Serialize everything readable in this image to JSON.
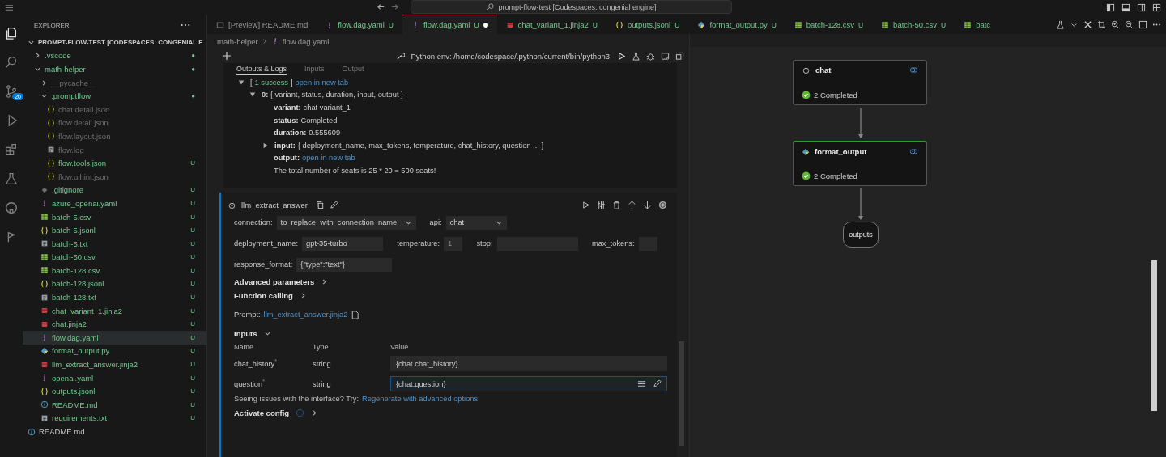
{
  "title_bar": {
    "search": "prompt-flow-test [Codespaces: congenial engine]"
  },
  "activity_bar": [
    {
      "kind": "files",
      "selected": true
    },
    {
      "kind": "search",
      "selected": false
    },
    {
      "kind": "source-control",
      "selected": false,
      "badge": "20"
    },
    {
      "kind": "run",
      "selected": false
    },
    {
      "kind": "extensions",
      "selected": false
    },
    {
      "kind": "flask",
      "selected": false
    },
    {
      "kind": "github",
      "selected": false
    },
    {
      "kind": "promptflow",
      "selected": false
    }
  ],
  "explorer": {
    "title": "EXPLORER",
    "items": [
      {
        "label": "PROMPT-FLOW-TEST [CODESPACES: CONGENIAL E...",
        "kind": "root",
        "expanded": true,
        "selected": false,
        "ignored": false,
        "children": [
          {
            "label": ".vscode",
            "kind": "folder",
            "expanded": false,
            "selected": false,
            "ignored": false,
            "badge": "●"
          },
          {
            "label": "math-helper",
            "kind": "folder",
            "expanded": true,
            "selected": false,
            "ignored": false,
            "badge": "●",
            "children": [
              {
                "label": "__pycache__",
                "kind": "folder",
                "expanded": false,
                "selected": false,
                "ignored": true
              },
              {
                "label": ".promptflow",
                "kind": "folder",
                "expanded": true,
                "selected": false,
                "ignored": false,
                "badge": "●",
                "children": [
                  {
                    "label": "chat.detail.json",
                    "kind": "json",
                    "selected": false,
                    "ignored": true
                  },
                  {
                    "label": "flow.detail.json",
                    "kind": "json",
                    "selected": false,
                    "ignored": true
                  },
                  {
                    "label": "flow.layout.json",
                    "kind": "json",
                    "selected": false,
                    "ignored": true
                  },
                  {
                    "label": "flow.log",
                    "kind": "text",
                    "selected": false,
                    "ignored": true
                  },
                  {
                    "label": "flow.tools.json",
                    "kind": "json",
                    "selected": false,
                    "ignored": false,
                    "badge": "U"
                  },
                  {
                    "label": "flow.uihint.json",
                    "kind": "json",
                    "selected": false,
                    "ignored": true
                  }
                ]
              },
              {
                "label": ".gitignore",
                "kind": "git",
                "selected": false,
                "ignored": false,
                "badge": "U"
              },
              {
                "label": "azure_openai.yaml",
                "kind": "yaml",
                "selected": false,
                "ignored": false,
                "badge": "U"
              },
              {
                "label": "batch-5.csv",
                "kind": "csv",
                "selected": false,
                "ignored": false,
                "badge": "U"
              },
              {
                "label": "batch-5.jsonl",
                "kind": "json",
                "selected": false,
                "ignored": false,
                "badge": "U"
              },
              {
                "label": "batch-5.txt",
                "kind": "text",
                "selected": false,
                "ignored": false,
                "badge": "U"
              },
              {
                "label": "batch-50.csv",
                "kind": "csv",
                "selected": false,
                "ignored": false,
                "badge": "U"
              },
              {
                "label": "batch-128.csv",
                "kind": "csv",
                "selected": false,
                "ignored": false,
                "badge": "U"
              },
              {
                "label": "batch-128.jsonl",
                "kind": "json",
                "selected": false,
                "ignored": false,
                "badge": "U"
              },
              {
                "label": "batch-128.txt",
                "kind": "text",
                "selected": false,
                "ignored": false,
                "badge": "U"
              },
              {
                "label": "chat_variant_1.jinja2",
                "kind": "jinja",
                "selected": false,
                "ignored": false,
                "badge": "U"
              },
              {
                "label": "chat.jinja2",
                "kind": "jinja",
                "selected": false,
                "ignored": false,
                "badge": "U"
              },
              {
                "label": "flow.dag.yaml",
                "kind": "yaml",
                "selected": true,
                "ignored": false,
                "badge": "U"
              },
              {
                "label": "format_output.py",
                "kind": "python",
                "selected": false,
                "ignored": false,
                "badge": "U"
              },
              {
                "label": "llm_extract_answer.jinja2",
                "kind": "jinja",
                "selected": false,
                "ignored": false,
                "badge": "U"
              },
              {
                "label": "openai.yaml",
                "kind": "yaml",
                "selected": false,
                "ignored": false,
                "badge": "U"
              },
              {
                "label": "outputs.jsonl",
                "kind": "json",
                "selected": false,
                "ignored": false,
                "badge": "U"
              },
              {
                "label": "README.md",
                "kind": "info",
                "selected": false,
                "ignored": false,
                "badge": "U"
              },
              {
                "label": "requirements.txt",
                "kind": "text",
                "selected": false,
                "ignored": false,
                "badge": "U"
              }
            ]
          }
        ]
      },
      {
        "label": "README.md",
        "kind": "info",
        "selected": false,
        "ignored": false
      }
    ]
  },
  "tabs": [
    {
      "label": "[Preview] README.md",
      "kind": "preview",
      "selected": false,
      "dirty": false,
      "untracked": false
    },
    {
      "label": "flow.dag.yaml",
      "kind": "yaml",
      "status": "U",
      "selected": false,
      "dirty": false,
      "untracked": true
    },
    {
      "label": "flow.dag.yaml",
      "kind": "yaml",
      "status": "U",
      "selected": true,
      "dirty": true,
      "untracked": true
    },
    {
      "label": "chat_variant_1.jinja2",
      "kind": "jinja",
      "status": "U",
      "selected": false,
      "dirty": false,
      "untracked": true
    },
    {
      "label": "outputs.jsonl",
      "kind": "json",
      "status": "U",
      "selected": false,
      "dirty": false,
      "untracked": true
    },
    {
      "label": "format_output.py",
      "kind": "python",
      "status": "U",
      "selected": false,
      "dirty": false,
      "untracked": true
    },
    {
      "label": "batch-128.csv",
      "kind": "csv",
      "status": "U",
      "selected": false,
      "dirty": false,
      "untracked": true
    },
    {
      "label": "batch-50.csv",
      "kind": "csv",
      "status": "U",
      "selected": false,
      "dirty": false,
      "untracked": true
    },
    {
      "label": "batc",
      "kind": "csv",
      "selected": false,
      "dirty": false,
      "untracked": true
    }
  ],
  "breadcrumb": [
    {
      "label": "math-helper",
      "kind": "folder"
    },
    {
      "label": "flow.dag.yaml",
      "kind": "yaml"
    }
  ],
  "toolbar": {
    "env": "Python env: /home/codespace/.python/current/bin/python3"
  },
  "outputs_panel": {
    "tabs": [
      {
        "label": "Outputs & Logs",
        "selected": true
      },
      {
        "label": "Inputs",
        "selected": false
      },
      {
        "label": "Output",
        "selected": false
      }
    ],
    "summary": {
      "open": "[",
      "status": "1 success",
      "close": "]",
      "link": "open in new tab",
      "expanded": true
    },
    "entry": {
      "key": "0:",
      "summary": "{ variant, status, duration, input, output }",
      "expanded": true,
      "fields": [
        {
          "key": "variant:",
          "value": "chat variant_1",
          "kind": "text"
        },
        {
          "key": "status:",
          "value": "Completed",
          "kind": "text"
        },
        {
          "key": "duration:",
          "value": "0.555609",
          "kind": "text"
        },
        {
          "key": "input:",
          "value": "{ deployment_name, max_tokens, temperature, chat_history, question ... }",
          "kind": "collapsed"
        },
        {
          "key": "output:",
          "value": "open in new tab",
          "kind": "link"
        }
      ],
      "result": "The total number of seats is 25 * 20 = 500 seats!"
    }
  },
  "node": {
    "title": "llm_extract_answer",
    "rows": [
      [
        {
          "label": "connection:",
          "value": "to_replace_with_connection_name",
          "kind": "select"
        },
        {
          "label": "api:",
          "value": "chat",
          "kind": "select"
        }
      ],
      [
        {
          "label": "deployment_name:",
          "value": "gpt-35-turbo",
          "kind": "input"
        },
        {
          "label": "temperature:",
          "placeholder": "1",
          "kind": "small"
        },
        {
          "label": "stop:",
          "kind": "input"
        },
        {
          "label": "max_tokens:",
          "kind": "small"
        }
      ],
      [
        {
          "label": "response_format:",
          "value": "{\"type\":\"text\"}",
          "kind": "input"
        }
      ]
    ],
    "sections": [
      {
        "label": "Advanced parameters",
        "expanded": false
      },
      {
        "label": "Function calling",
        "expanded": false
      }
    ],
    "prompt": {
      "label": "Prompt:",
      "link": "llm_extract_answer.jinja2"
    },
    "inputs": {
      "title": "Inputs",
      "expanded": true,
      "columns": [
        "Name",
        "Type",
        "Value"
      ],
      "rows": [
        {
          "name": "chat_history",
          "required": "*",
          "type": "string",
          "value": "{chat.chat_history}",
          "focused": false
        },
        {
          "name": "question",
          "required": "*",
          "type": "string",
          "value": "{chat.question}",
          "focused": true
        }
      ]
    },
    "hint": {
      "text": "Seeing issues with the interface? Try:",
      "link": "Regenerate with advanced options"
    },
    "activate": {
      "label": "Activate config",
      "expanded": false
    }
  },
  "graph": {
    "nodes": [
      {
        "name": "chat",
        "kind": "llm",
        "status": "2 Completed",
        "selected": false
      },
      {
        "name": "format_output",
        "kind": "python",
        "status": "2 Completed",
        "selected": true
      }
    ],
    "output": "outputs"
  }
}
